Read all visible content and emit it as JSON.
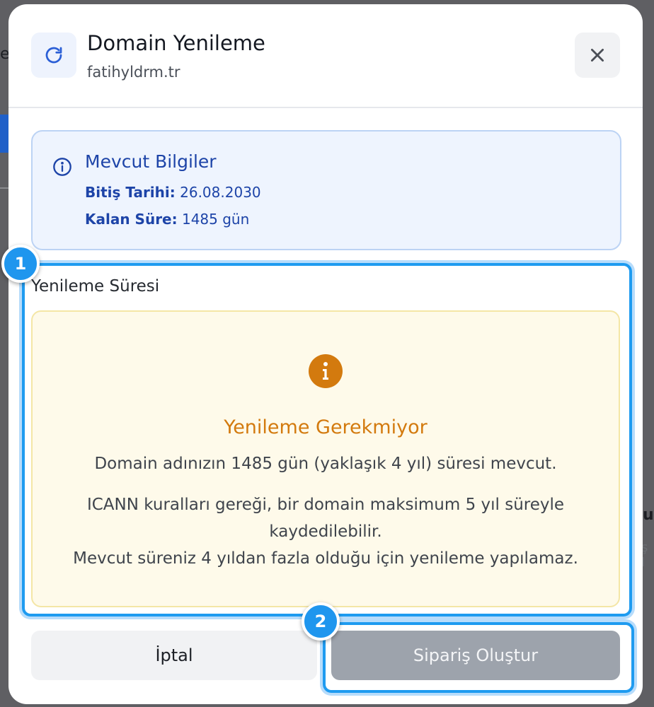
{
  "background": {
    "text_e": "e",
    "text_u": "u",
    "text_s": "ş I",
    "strip_color": "#1f5fc8"
  },
  "modal": {
    "title": "Domain Yenileme",
    "subtitle": "fatihyldrm.tr",
    "header_icon": "refresh-icon",
    "close_icon": "close-icon"
  },
  "current_info": {
    "title": "Mevcut Bilgiler",
    "expiry_label": "Bitiş Tarihi:",
    "expiry_value": "26.08.2030",
    "remaining_label": "Kalan Süre:",
    "remaining_value": "1485 gün",
    "icon": "info-icon",
    "color": "#1d44a8"
  },
  "renewal": {
    "label": "Yenileme Süresi",
    "notice_title": "Yenileme Gerekmiyor",
    "notice_line1": "Domain adınızın 1485 gün (yaklaşık 4 yıl) süresi mevcut.",
    "notice_line2a": "ICANN kuralları gereği, bir domain maksimum 5 yıl süreyle",
    "notice_line2b": "kaydedilebilir.",
    "notice_line3": "Mevcut süreniz 4 yıldan fazla olduğu için yenileme yapılamaz.",
    "icon": "warning-info-icon",
    "accent": "#d37a0e"
  },
  "actions": {
    "cancel_label": "İptal",
    "order_label": "Sipariş Oluştur"
  },
  "badges": {
    "first": "1",
    "second": "2",
    "color": "#1f96ee"
  }
}
